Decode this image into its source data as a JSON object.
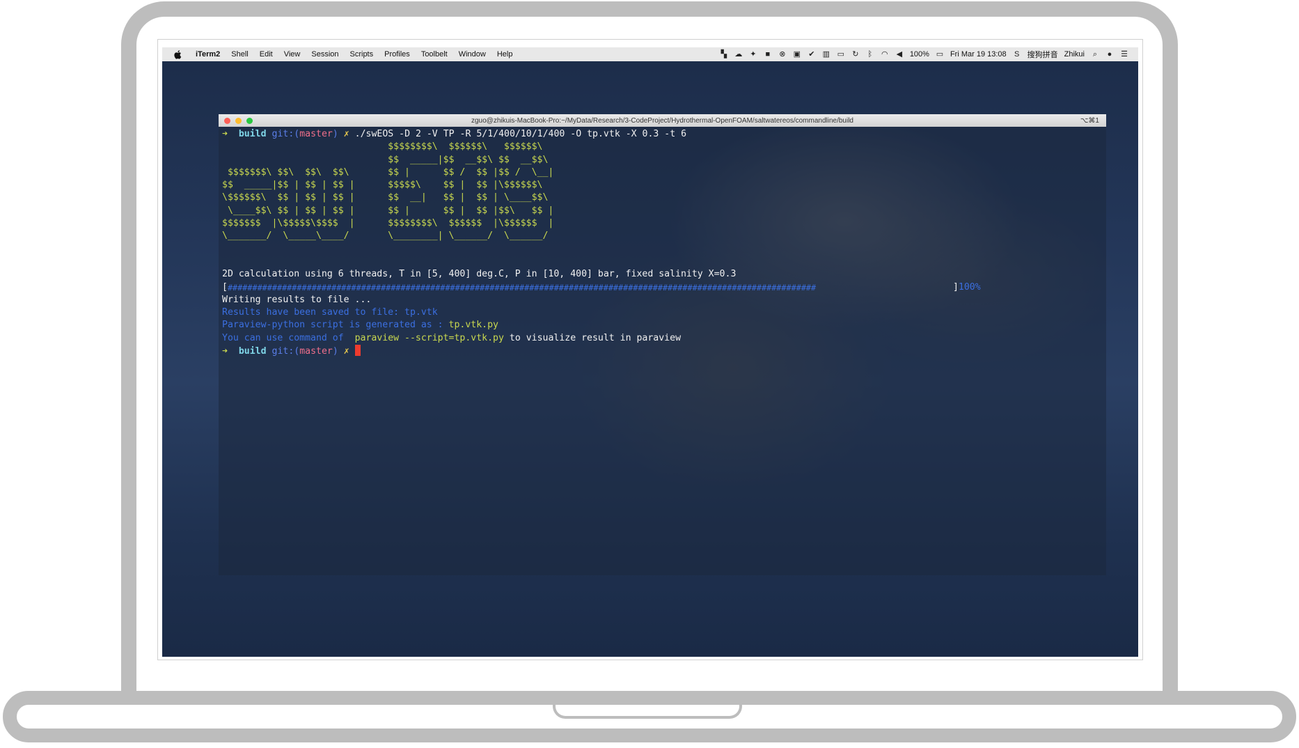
{
  "menubar": {
    "app_name": "iTerm2",
    "menus": [
      "Shell",
      "Edit",
      "View",
      "Session",
      "Scripts",
      "Profiles",
      "Toolbelt",
      "Window",
      "Help"
    ],
    "battery": "100%",
    "datetime": "Fri Mar 19  13:08",
    "input_method": "搜狗拼音",
    "user": "Zhikui"
  },
  "window": {
    "title": "zguo@zhikuis-MacBook-Pro:~/MyData/Research/3-CodeProject/Hydrothermal-OpenFOAM/saltwatereos/commandline/build",
    "shortcut": "⌥⌘1"
  },
  "terminal": {
    "prompt_arrow": "➜",
    "prompt_dir": "build",
    "prompt_git": "git:(",
    "prompt_branch": "master",
    "prompt_git_close": ")",
    "prompt_x": "✗",
    "command": "./swEOS -D 2 -V TP -R 5/1/400/10/1/400 -O tp.vtk -X 0.3 -t 6",
    "ascii_art": [
      "                              $$$$$$$$\\  $$$$$$\\   $$$$$$\\",
      "                              $$  _____|$$  __$$\\ $$  __$$\\",
      " $$$$$$$\\ $$\\  $$\\  $$\\       $$ |      $$ /  $$ |$$ /  \\__|",
      "$$  _____|$$ | $$ | $$ |      $$$$$\\    $$ |  $$ |\\$$$$$$\\",
      "\\$$$$$$\\  $$ | $$ | $$ |      $$  __|   $$ |  $$ | \\____$$\\",
      " \\____$$\\ $$ | $$ | $$ |      $$ |      $$ |  $$ |$$\\   $$ |",
      "$$$$$$$  |\\$$$$$\\$$$$  |      $$$$$$$$\\  $$$$$$  |\\$$$$$$  |",
      "\\_______/  \\_____\\____/       \\________| \\______/  \\______/"
    ],
    "calc_line": "2D calculation using 6 threads, T in [5, 400] deg.C, P in [10, 400] bar, fixed salinity X=0.3",
    "progress_open": "[",
    "progress_fill": "#######################################################################################################################",
    "progress_close": "]",
    "progress_percent": "100%",
    "writing_line": "Writing results to file ...",
    "saved_line": "Results have been saved to file: tp.vtk",
    "script_line_prefix": "Paraview-python script is generated as : ",
    "script_name": "tp.vtk.py",
    "use_prefix": "You can use command of  ",
    "use_command": "paraview --script=tp.vtk.py",
    "use_suffix": " to visualize result in paraview"
  }
}
